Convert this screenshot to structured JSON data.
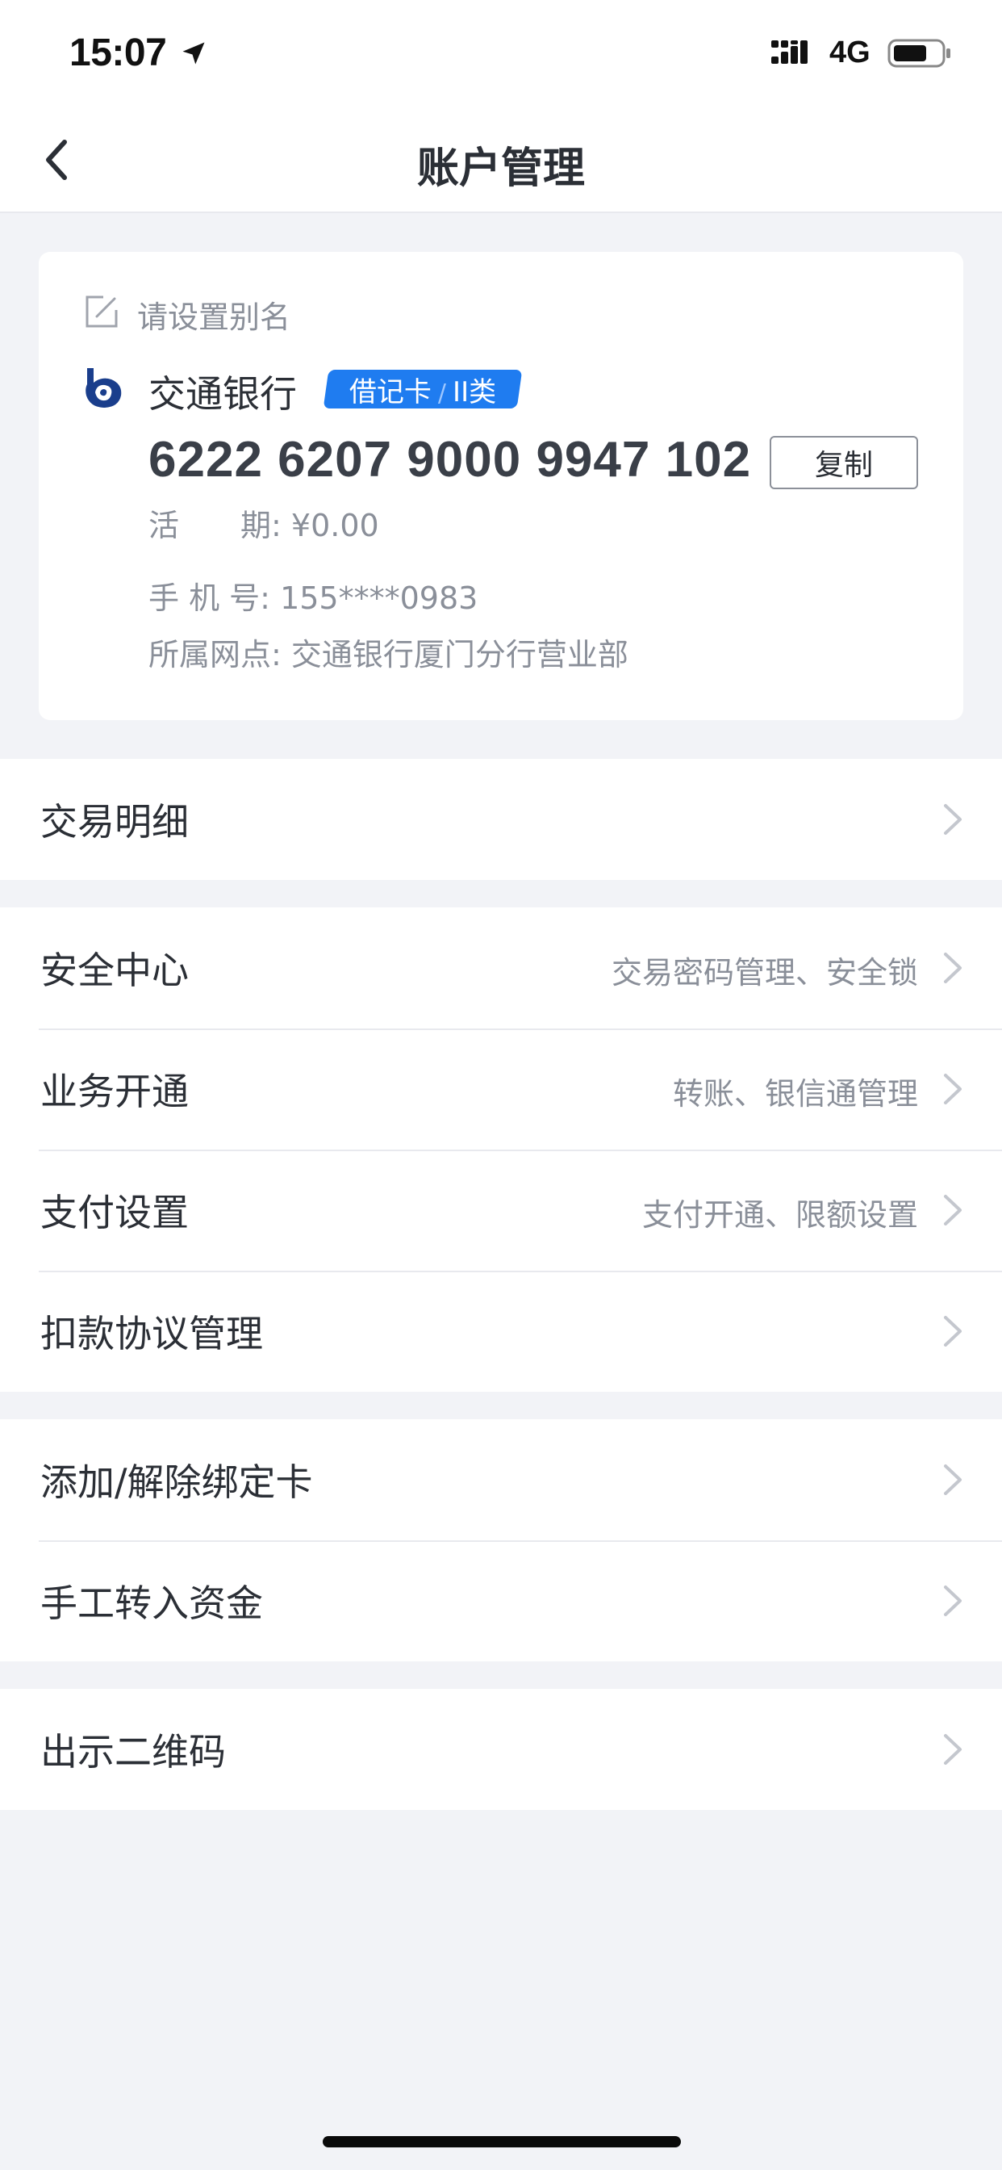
{
  "status_bar": {
    "time": "15:07",
    "network": "4G",
    "icons": [
      "location-arrow-icon",
      "signal-icon",
      "battery-icon"
    ]
  },
  "nav": {
    "title": "账户管理",
    "back_icon": "chevron-left-icon"
  },
  "account": {
    "alias_prompt": "请设置别名",
    "bank_name": "交通银行",
    "card_type": "借记卡",
    "card_class": "II类",
    "card_number": "6222 6207 9000 9947 102",
    "copy_label": "复制",
    "balance_label": "活　　期:",
    "balance_value": "¥0.00",
    "phone_label": "手  机  号:",
    "phone_value": "155****0983",
    "branch_label": "所属网点:",
    "branch_value": "交通银行厦门分行营业部"
  },
  "menu": {
    "group1": [
      {
        "label": "交易明细",
        "sub": ""
      }
    ],
    "group2": [
      {
        "label": "安全中心",
        "sub": "交易密码管理、安全锁"
      },
      {
        "label": "业务开通",
        "sub": "转账、银信通管理"
      },
      {
        "label": "支付设置",
        "sub": "支付开通、限额设置"
      },
      {
        "label": "扣款协议管理",
        "sub": ""
      }
    ],
    "group3": [
      {
        "label": "添加/解除绑定卡",
        "sub": ""
      },
      {
        "label": "手工转入资金",
        "sub": ""
      }
    ],
    "group4": [
      {
        "label": "出示二维码",
        "sub": ""
      }
    ]
  },
  "colors": {
    "accent": "#1f7cf0",
    "background": "#f2f3f7",
    "secondary_text": "#8a8f99"
  }
}
